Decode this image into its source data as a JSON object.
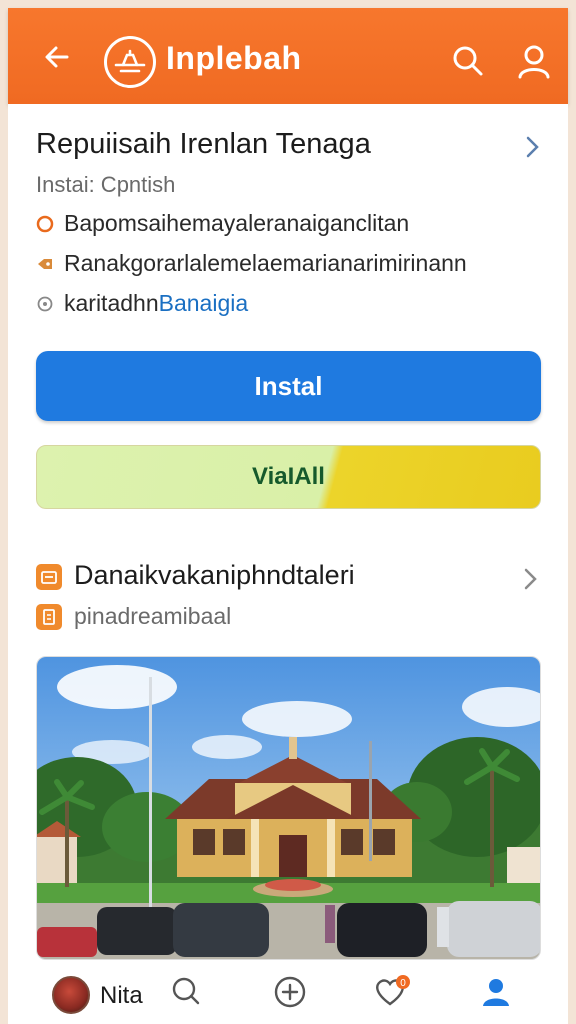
{
  "header": {
    "title": "Inplebah",
    "back_icon": "arrow-left-icon",
    "logo_icon": "plane-logo-icon",
    "search_icon": "search-icon",
    "profile_icon": "user-icon",
    "color": "#f36f27"
  },
  "app": {
    "name": "Repuiisaih Irenlan Tenaga",
    "subtitle": "Instai: Cpntish",
    "details": [
      {
        "icon": "circle-outline-icon",
        "text": "Bapomsaihemayaleranaiganclitan"
      },
      {
        "icon": "tag-icon",
        "text": "Ranakgorarlalemelaemarianarimirinann"
      },
      {
        "icon": "info-circle-icon",
        "text": "karitadhn ",
        "link": "Banaigia"
      }
    ]
  },
  "buttons": {
    "install": "Instal",
    "view_all": "ViaIAll",
    "install_color": "#1f7ae0"
  },
  "section": {
    "title": "Danaikvakaniphndtaleri",
    "subtitle": "pinadreamibaal",
    "title_icon": "calendar-icon",
    "subtitle_icon": "document-icon"
  },
  "photo": {
    "alt": "building-photo"
  },
  "bottom_nav": {
    "user_name": "Nita",
    "items": [
      {
        "icon": "search-icon"
      },
      {
        "icon": "add-icon"
      },
      {
        "icon": "heart-icon",
        "badge": "0"
      },
      {
        "icon": "user-icon",
        "active": true
      }
    ],
    "active_color": "#1f7ae0"
  }
}
